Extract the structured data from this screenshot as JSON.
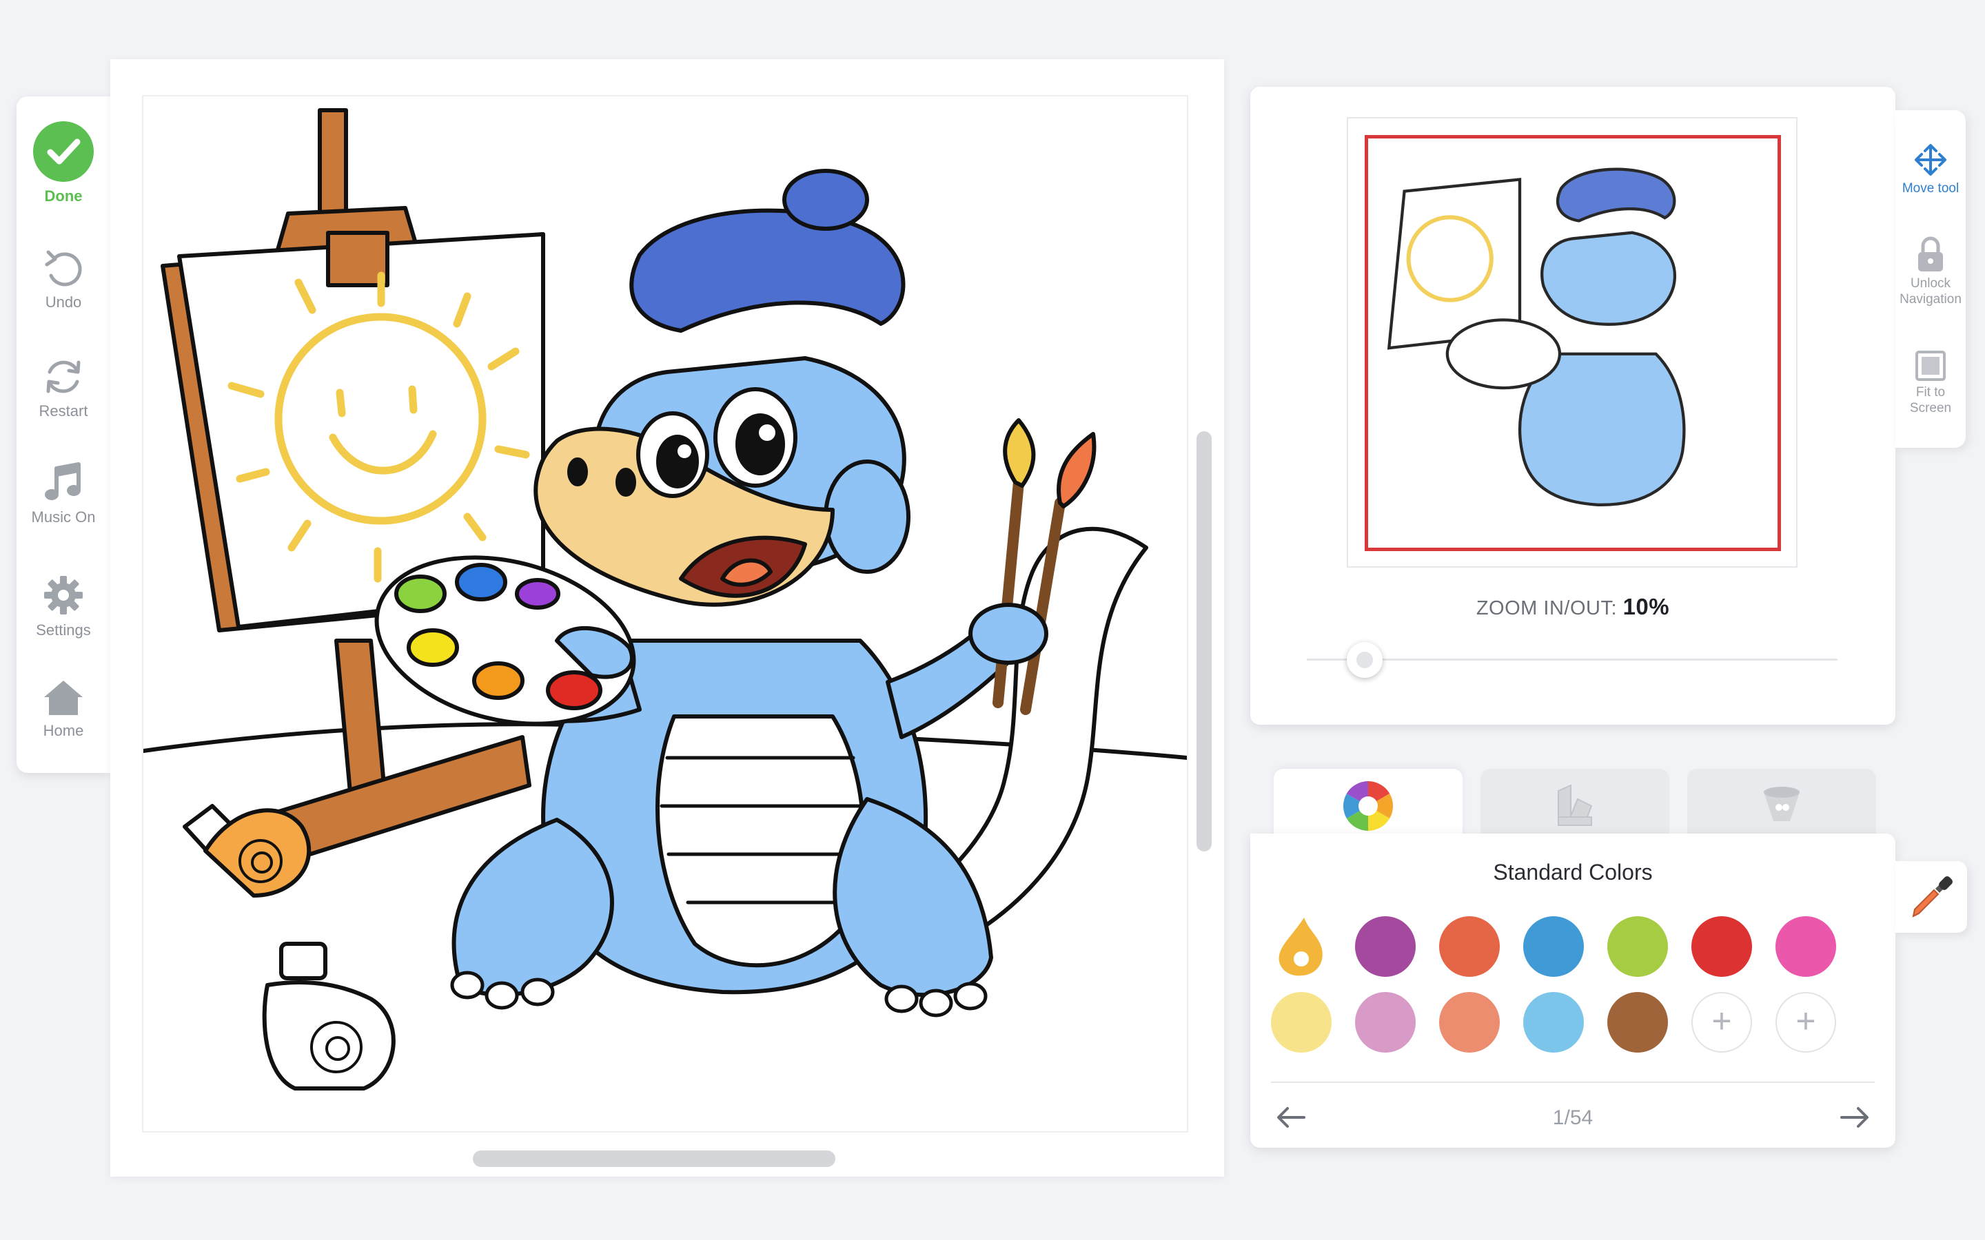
{
  "toolbar": {
    "done": "Done",
    "undo": "Undo",
    "restart": "Restart",
    "music": "Music On",
    "settings": "Settings",
    "home": "Home"
  },
  "navigator": {
    "zoom_label": "ZOOM IN/OUT:",
    "zoom_value": "10%",
    "zoom_level": 0.1,
    "move_tool": "Move tool",
    "unlock_line1": "Unlock",
    "unlock_line2": "Navigation",
    "fit_line1": "Fit to",
    "fit_line2": "Screen"
  },
  "palette": {
    "tabs": [
      "color-wheel",
      "textures",
      "patterns"
    ],
    "title": "Standard Colors",
    "row1": [
      "#f3b63b",
      "#a34a9e",
      "#e56547",
      "#3f9ad6",
      "#a6cc44",
      "#dd3232",
      "#ea57ab"
    ],
    "row2": [
      "#f7e38a",
      "#d89bc8",
      "#ec8d70",
      "#7cc5ea",
      "#a0643a"
    ],
    "add_label": "+",
    "page": "1/54"
  },
  "colors": {
    "accent": "#2f7fd1",
    "done_green": "#5cbf52",
    "viewport_red": "#d8383a",
    "dino_blue": "#8fc3f5",
    "beret": "#4c6fd0",
    "sun": "#f2cb4a"
  },
  "icons": {
    "done": "checkmark-icon",
    "undo": "undo-icon",
    "restart": "restart-icon",
    "music": "music-note-icon",
    "settings": "gear-icon",
    "home": "home-icon",
    "move": "move-arrows-icon",
    "lock": "lock-icon",
    "fit": "fit-screen-icon",
    "picker": "eyedropper-icon"
  }
}
